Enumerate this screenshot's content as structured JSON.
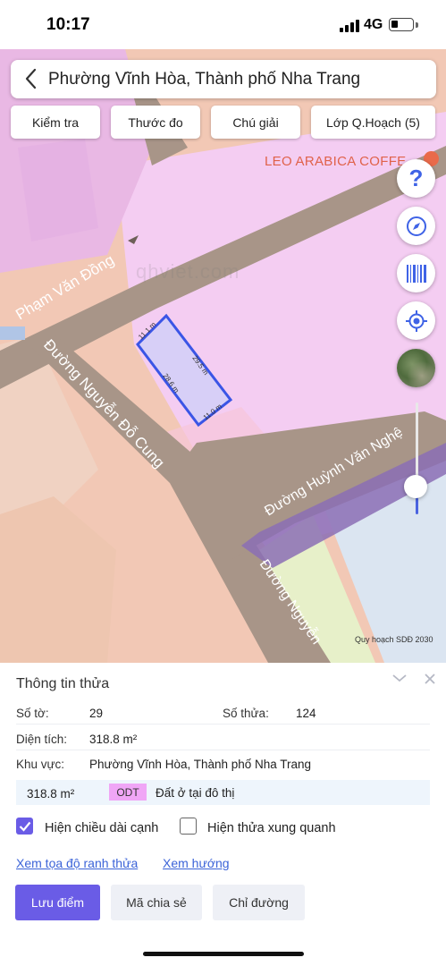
{
  "status_bar": {
    "time": "10:17",
    "network": "4G"
  },
  "search_bar": {
    "title": "Phường Vĩnh Hòa, Thành phố Nha Trang"
  },
  "top_buttons": [
    {
      "label": "Kiểm tra"
    },
    {
      "label": "Thước đo"
    },
    {
      "label": "Chú giải"
    },
    {
      "label": "Lớp Q.Hoạch (5)"
    }
  ],
  "map": {
    "poi_label": "LEO ARABICA COFFE",
    "watermark": "qhviet.com",
    "copyright": "Quy hoạch SDĐ 2030",
    "streets": {
      "pham_van_dong": "Phạm Văn Đồng",
      "nguyen_do_cung": "Đường Nguyễn Đỗ Cung",
      "huynh_van_nghe": "Đường Huỳnh Văn Nghệ",
      "nguyen_partial": "Đường Nguyễn"
    },
    "parcel_dims": {
      "top": "11.1 m",
      "right": "29.5 m",
      "left": "28.6 m",
      "bottom": "11.0 m"
    },
    "zoom_level_fraction": 0.2
  },
  "right_controls": [
    {
      "icon": "help-icon"
    },
    {
      "icon": "compass-icon"
    },
    {
      "icon": "barcode-icon"
    },
    {
      "icon": "locate-icon"
    },
    {
      "icon": "satellite-layer-icon"
    }
  ],
  "panel": {
    "title": "Thông tin thửa",
    "so_to_label": "Số tờ:",
    "so_to_value": "29",
    "so_thua_label": "Số thửa:",
    "so_thua_value": "124",
    "dien_tich_label": "Diện tích:",
    "dien_tich_value": "318.8 m²",
    "khu_vuc_label": "Khu vực:",
    "khu_vuc_value": "Phường Vĩnh Hòa, Thành phố Nha Trang",
    "zone_area": "318.8 m²",
    "zone_code": "ODT",
    "zone_desc": "Đất ở tại đô thị",
    "checkbox_edges_label": "Hiện chiều dài cạnh",
    "checkbox_edges_checked": true,
    "checkbox_neighbors_label": "Hiện thửa xung quanh",
    "checkbox_neighbors_checked": false,
    "link_coordinates": "Xem tọa độ ranh thửa",
    "link_direction": "Xem hướng",
    "btn_save": "Lưu điểm",
    "btn_share": "Mã chia sẻ",
    "btn_directions": "Chỉ đường"
  },
  "colors": {
    "accent": "#6a5ce6",
    "link": "#3b63d8",
    "road": "#a59488",
    "parcel_highlight": "#3a55e6",
    "zone_residential": "#f3c9f0",
    "zone_mixed": "#f3c9b6"
  }
}
